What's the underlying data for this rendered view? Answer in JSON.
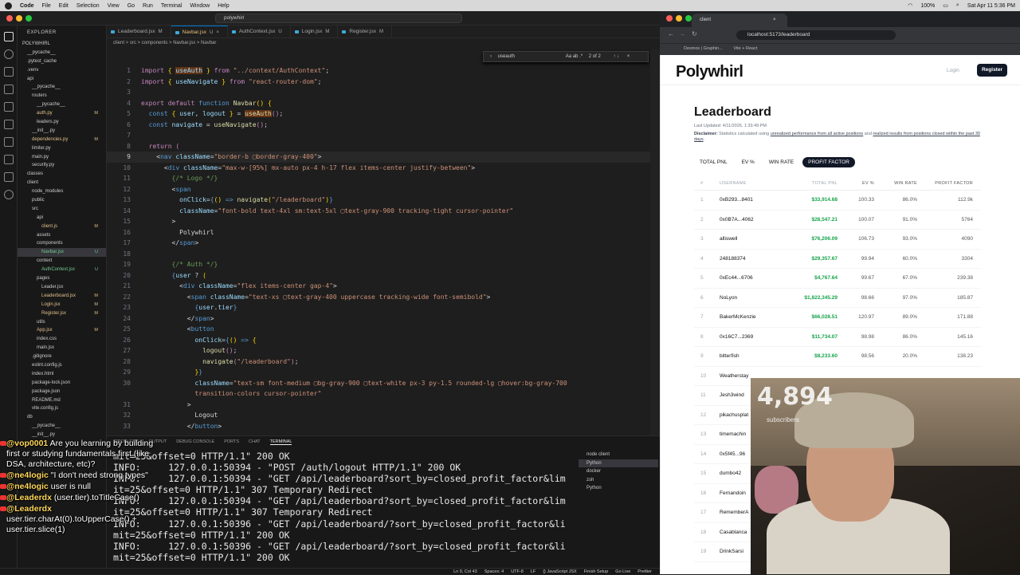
{
  "menubar": {
    "app": "Code",
    "items": [
      "File",
      "Edit",
      "Selection",
      "View",
      "Go",
      "Run",
      "Terminal",
      "Window",
      "Help"
    ],
    "battery": "100%",
    "clock": "Sat Apr 11  5:36 PM"
  },
  "vscode": {
    "command_center": "polywhirl",
    "explorer_title": "EXPLORER",
    "tree": [
      {
        "name": "POLYWHIRL",
        "indent": 0,
        "badge": ""
      },
      {
        "name": "__pycache__",
        "indent": 1,
        "badge": ""
      },
      {
        "name": ".pytest_cache",
        "indent": 1,
        "badge": ""
      },
      {
        "name": ".venv",
        "indent": 1,
        "badge": ""
      },
      {
        "name": "api",
        "indent": 1,
        "badge": ""
      },
      {
        "name": "__pycache__",
        "indent": 2,
        "badge": ""
      },
      {
        "name": "routers",
        "indent": 2,
        "badge": ""
      },
      {
        "name": "__pycache__",
        "indent": 3,
        "badge": ""
      },
      {
        "name": "auth.py",
        "indent": 3,
        "badge": "M"
      },
      {
        "name": "leaders.py",
        "indent": 3,
        "badge": ""
      },
      {
        "name": "__init__.py",
        "indent": 2,
        "badge": ""
      },
      {
        "name": "dependencies.py",
        "indent": 2,
        "badge": "M"
      },
      {
        "name": "limiter.py",
        "indent": 2,
        "badge": ""
      },
      {
        "name": "main.py",
        "indent": 2,
        "badge": ""
      },
      {
        "name": "security.py",
        "indent": 2,
        "badge": ""
      },
      {
        "name": "classes",
        "indent": 1,
        "badge": ""
      },
      {
        "name": "client",
        "indent": 1,
        "badge": ""
      },
      {
        "name": "node_modules",
        "indent": 2,
        "badge": ""
      },
      {
        "name": "public",
        "indent": 2,
        "badge": ""
      },
      {
        "name": "src",
        "indent": 2,
        "badge": ""
      },
      {
        "name": "api",
        "indent": 3,
        "badge": ""
      },
      {
        "name": "client.js",
        "indent": 4,
        "badge": "M"
      },
      {
        "name": "assets",
        "indent": 3,
        "badge": ""
      },
      {
        "name": "components",
        "indent": 3,
        "badge": ""
      },
      {
        "name": "Navbar.jsx",
        "indent": 4,
        "badge": "U"
      },
      {
        "name": "context",
        "indent": 3,
        "badge": ""
      },
      {
        "name": "AuthContext.jsx",
        "indent": 4,
        "badge": "U"
      },
      {
        "name": "pages",
        "indent": 3,
        "badge": ""
      },
      {
        "name": "Leader.jsx",
        "indent": 4,
        "badge": ""
      },
      {
        "name": "Leaderboard.jsx",
        "indent": 4,
        "badge": "M"
      },
      {
        "name": "Login.jsx",
        "indent": 4,
        "badge": "M"
      },
      {
        "name": "Register.jsx",
        "indent": 4,
        "badge": "M"
      },
      {
        "name": "utils",
        "indent": 3,
        "badge": ""
      },
      {
        "name": "App.jsx",
        "indent": 3,
        "badge": "M"
      },
      {
        "name": "index.css",
        "indent": 3,
        "badge": ""
      },
      {
        "name": "main.jsx",
        "indent": 3,
        "badge": ""
      },
      {
        "name": ".gitignore",
        "indent": 2,
        "badge": ""
      },
      {
        "name": "eslint.config.js",
        "indent": 2,
        "badge": ""
      },
      {
        "name": "index.html",
        "indent": 2,
        "badge": ""
      },
      {
        "name": "package-lock.json",
        "indent": 2,
        "badge": ""
      },
      {
        "name": "package.json",
        "indent": 2,
        "badge": ""
      },
      {
        "name": "README.md",
        "indent": 2,
        "badge": ""
      },
      {
        "name": "vite.config.js",
        "indent": 2,
        "badge": ""
      },
      {
        "name": "db",
        "indent": 1,
        "badge": ""
      },
      {
        "name": "__pycache__",
        "indent": 2,
        "badge": ""
      },
      {
        "name": "__init__.py",
        "indent": 2,
        "badge": ""
      }
    ],
    "tabs": [
      {
        "label": "Leaderboard.jsx",
        "mark": "M",
        "active": false
      },
      {
        "label": "Navbar.jsx",
        "mark": "U",
        "active": true
      },
      {
        "label": "AuthContext.jsx",
        "mark": "U",
        "active": false
      },
      {
        "label": "Login.jsx",
        "mark": "M",
        "active": false
      },
      {
        "label": "Register.jsx",
        "mark": "M",
        "active": false
      }
    ],
    "breadcrumb": "client  >  src  >  components  >  Navbar.jsx  >  Navbar",
    "find": {
      "query": "useauth",
      "count": "2 of 2"
    },
    "code_lines": [
      {
        "n": "1",
        "html": "<span class=\"kw\">import</span> <span class=\"br\">{</span> <span class=\"vr hl\">useAuth</span> <span class=\"br\">}</span> <span class=\"kw\">from</span> <span class=\"str\">\"../context/AuthContext\"</span>;"
      },
      {
        "n": "2",
        "html": "<span class=\"kw\">import</span> <span class=\"br\">{</span> <span class=\"vr\">useNavigate</span> <span class=\"br\">}</span> <span class=\"kw\">from</span> <span class=\"str\">\"react-router-dom\"</span>;"
      },
      {
        "n": "3",
        "html": ""
      },
      {
        "n": "4",
        "html": "<span class=\"kw\">export default</span> <span class=\"tag\">function</span> <span class=\"fn\">Navbar</span><span class=\"br\">()</span> <span class=\"br\">{</span>"
      },
      {
        "n": "5",
        "html": "  <span class=\"tag\">const</span> <span class=\"br\">{</span> <span class=\"vr\">user</span>, <span class=\"vr\">logout</span> <span class=\"br\">}</span> = <span class=\"fn hl\">useAuth</span><span class=\"kw\">()</span>;"
      },
      {
        "n": "6",
        "html": "  <span class=\"tag\">const</span> <span class=\"vr\">navigate</span> = <span class=\"fn\">useNavigate</span><span class=\"kw\">()</span>;"
      },
      {
        "n": "7",
        "html": ""
      },
      {
        "n": "8",
        "html": "  <span class=\"kw\">return</span> <span class=\"kw\">(</span>"
      },
      {
        "n": "9",
        "html": "    <span class=\"pu\">&lt;</span><span class=\"tag\">nav</span> <span class=\"vr\">className</span>=<span class=\"str\">\"border-b ▢border-gray-400\"</span><span class=\"pu\">&gt;</span>",
        "cur": true
      },
      {
        "n": "10",
        "html": "      <span class=\"pu\">&lt;</span><span class=\"tag\">div</span> <span class=\"vr\">className</span>=<span class=\"str\">\"max-w-[95%] mx-auto px-4 h-17 flex items-center justify-between\"</span><span class=\"pu\">&gt;</span>"
      },
      {
        "n": "11",
        "html": "        <span class=\"cm\">{/* Logo */}</span>"
      },
      {
        "n": "12",
        "html": "        <span class=\"pu\">&lt;</span><span class=\"tag\">span</span>"
      },
      {
        "n": "13",
        "html": "          <span class=\"vr\">onClick</span>=<span class=\"tag\">{</span><span class=\"br\">()</span> <span class=\"tag\">=&gt;</span> <span class=\"fn\">navigate</span><span class=\"br\">(</span><span class=\"str\">\"/leaderboard\"</span><span class=\"br\">)</span><span class=\"tag\">}</span>"
      },
      {
        "n": "14",
        "html": "          <span class=\"vr\">className</span>=<span class=\"str\">\"font-bold text-4xl sm:text-5xl ▢text-gray-900 tracking-tight cursor-pointer\"</span>"
      },
      {
        "n": "15",
        "html": "        <span class=\"pu\">&gt;</span>"
      },
      {
        "n": "16",
        "html": "          Polywhirl"
      },
      {
        "n": "17",
        "html": "        <span class=\"pu\">&lt;/</span><span class=\"tag\">span</span><span class=\"pu\">&gt;</span>"
      },
      {
        "n": "18",
        "html": ""
      },
      {
        "n": "19",
        "html": "        <span class=\"cm\">{/* Auth */}</span>"
      },
      {
        "n": "20",
        "html": "        <span class=\"tag\">{</span><span class=\"vr\">user</span> ? <span class=\"br\">(</span>"
      },
      {
        "n": "21",
        "html": "          <span class=\"pu\">&lt;</span><span class=\"tag\">div</span> <span class=\"vr\">className</span>=<span class=\"str\">\"flex items-center gap-4\"</span><span class=\"pu\">&gt;</span>"
      },
      {
        "n": "22",
        "html": "            <span class=\"pu\">&lt;</span><span class=\"tag\">span</span> <span class=\"vr\">className</span>=<span class=\"str\">\"text-xs ▢text-gray-400 uppercase tracking-wide font-semibold\"</span><span class=\"pu\">&gt;</span>"
      },
      {
        "n": "23",
        "html": "              <span class=\"tag\">{</span><span class=\"vr\">user</span>.<span class=\"vr\">tier</span><span class=\"tag\">}</span>"
      },
      {
        "n": "24",
        "html": "            <span class=\"pu\">&lt;/</span><span class=\"tag\">span</span><span class=\"pu\">&gt;</span>"
      },
      {
        "n": "25",
        "html": "            <span class=\"pu\">&lt;</span><span class=\"tag\">button</span>"
      },
      {
        "n": "26",
        "html": "              <span class=\"vr\">onClick</span>=<span class=\"tag\">{</span><span class=\"br\">()</span> <span class=\"tag\">=&gt;</span> <span class=\"br\">{</span>"
      },
      {
        "n": "27",
        "html": "                <span class=\"fn\">logout</span><span class=\"kw\">()</span>;"
      },
      {
        "n": "28",
        "html": "                <span class=\"fn\">navigate</span><span class=\"kw\">(</span><span class=\"str\">\"/leaderboard\"</span><span class=\"kw\">)</span>;"
      },
      {
        "n": "29",
        "html": "              <span class=\"br\">}</span><span class=\"tag\">}</span>"
      },
      {
        "n": "30",
        "html": "              <span class=\"vr\">className</span>=<span class=\"str\">\"text-sm font-medium ▢bg-gray-900 ▢text-white px-3 py-1.5 rounded-lg ▢hover:bg-gray-700</span>"
      },
      {
        "n": "",
        "html": "              <span class=\"str\">transition-colors cursor-pointer\"</span>"
      },
      {
        "n": "31",
        "html": "            <span class=\"pu\">&gt;</span>"
      },
      {
        "n": "32",
        "html": "              Logout"
      },
      {
        "n": "33",
        "html": "            <span class=\"pu\">&lt;/</span><span class=\"tag\">button</span><span class=\"pu\">&gt;</span>"
      }
    ],
    "panel_tabs": [
      "PROBLEMS",
      "OUTPUT",
      "DEBUG CONSOLE",
      "PORTS",
      "CHAT",
      "TERMINAL"
    ],
    "terminal_lines": [
      "mit=25&offset=0 HTTP/1.1\" 200 OK",
      "INFO:     127.0.0.1:50394 - \"POST /auth/logout HTTP/1.1\" 200 OK",
      "INFO:     127.0.0.1:50394 - \"GET /api/leaderboard?sort_by=closed_profit_factor&lim",
      "it=25&offset=0 HTTP/1.1\" 307 Temporary Redirect",
      "INFO:     127.0.0.1:50394 - \"GET /api/leaderboard?sort_by=closed_profit_factor&lim",
      "it=25&offset=0 HTTP/1.1\" 307 Temporary Redirect",
      "INFO:     127.0.0.1:50396 - \"GET /api/leaderboard/?sort_by=closed_profit_factor&li",
      "mit=25&offset=0 HTTP/1.1\" 200 OK",
      "INFO:     127.0.0.1:50396 - \"GET /api/leaderboard/?sort_by=closed_profit_factor&li",
      "mit=25&offset=0 HTTP/1.1\" 200 OK"
    ],
    "terminal_list": [
      "node client",
      "Python",
      "docker",
      "zsh",
      "Python"
    ],
    "status_bar": [
      "Ln 9, Col 43",
      "Spaces: 4",
      "UTF-8",
      "LF",
      "{} JavaScript JSX",
      "Finish Setup",
      "Go Live",
      "Prettier"
    ]
  },
  "chat": [
    {
      "user": "@vop0001",
      "text": "Are you learning by building first or studying fundamentals first (like DSA, architecture, etc)?"
    },
    {
      "user": "@ne4logic",
      "text": "\"I don't need strong types\""
    },
    {
      "user": "@ne4logic",
      "text": "user is null"
    },
    {
      "user": "@Leaderdx",
      "text": "(user.tier).toTitleCase()"
    },
    {
      "user": "@Leaderdx",
      "text": "user.tier.charAt(0).toUpperCase() + user.tier.slice(1)"
    }
  ],
  "browser": {
    "tab_title": "client",
    "url": "localhost:5173/leaderboard",
    "bookmarks": [
      "Desmos | Graphin...",
      "Vite + React"
    ],
    "site": {
      "logo": "Polywhirl",
      "login": "Login",
      "register": "Register",
      "title": "Leaderboard",
      "last_updated": "Last Updated: 4/11/2026, 1:33:49 PM",
      "disclaimer_label": "Disclaimer:",
      "disclaimer_text": " Statistics calculated using ",
      "disclaimer_link1": "unrealized performance from all active positions",
      "disclaimer_and": " and ",
      "disclaimer_link2": "realized results from positions closed within the past 30 days",
      "disclaimer_end": ".",
      "sort_buttons": [
        "TOTAL PNL",
        "EV %",
        "WIN RATE",
        "PROFIT FACTOR"
      ],
      "active_sort": "PROFIT FACTOR",
      "columns": [
        "#",
        "USERNAME",
        "TOTAL PNL",
        "EV %",
        "WIN RATE",
        "PROFIT FACTOR"
      ],
      "rows": [
        [
          "1",
          "0xB293...8401",
          "$33,914.68",
          "100.33",
          "86.0%",
          "112.9k"
        ],
        [
          "2",
          "0x0B7A...4062",
          "$28,547.21",
          "100.07",
          "91.0%",
          "5764"
        ],
        [
          "3",
          "alliswell",
          "$76,206.09",
          "106.73",
          "93.0%",
          "4090"
        ],
        [
          "4",
          "248188374",
          "$29,357.67",
          "99.94",
          "60.0%",
          "3304"
        ],
        [
          "5",
          "0xEc44...6706",
          "$4,767.64",
          "99.67",
          "67.0%",
          "239.38"
        ],
        [
          "6",
          "NoLyon",
          "$1,822,345.29",
          "98.66",
          "97.0%",
          "185.87"
        ],
        [
          "7",
          "BakerMcKenzie",
          "$66,028.51",
          "120.97",
          "89.0%",
          "171.88"
        ],
        [
          "8",
          "0x16C7...2369",
          "$11,734.07",
          "98.98",
          "86.0%",
          "145.16"
        ],
        [
          "9",
          "bitterfish",
          "$8,233.60",
          "98.56",
          "20.0%",
          "138.23"
        ],
        [
          "10",
          "Weatherstay",
          "",
          "",
          "",
          ""
        ],
        [
          "11",
          "Jesh3wind",
          "",
          "",
          "",
          ""
        ],
        [
          "12",
          "pikachusplat",
          "",
          "",
          "",
          ""
        ],
        [
          "13",
          "timemachin",
          "",
          "",
          "",
          ""
        ],
        [
          "14",
          "0x5f45...96",
          "",
          "",
          "",
          ""
        ],
        [
          "15",
          "dumbo42",
          "",
          "",
          "",
          ""
        ],
        [
          "16",
          "Fernandoin",
          "",
          "",
          "",
          ""
        ],
        [
          "17",
          "RememberA",
          "",
          "",
          "",
          ""
        ],
        [
          "18",
          "Casablanca",
          "",
          "",
          "",
          ""
        ],
        [
          "19",
          "DrinkSarsi",
          "",
          "",
          "",
          ""
        ]
      ]
    }
  },
  "webcam": {
    "subscriber_count": "4,894",
    "subscriber_label": "subscribers"
  }
}
